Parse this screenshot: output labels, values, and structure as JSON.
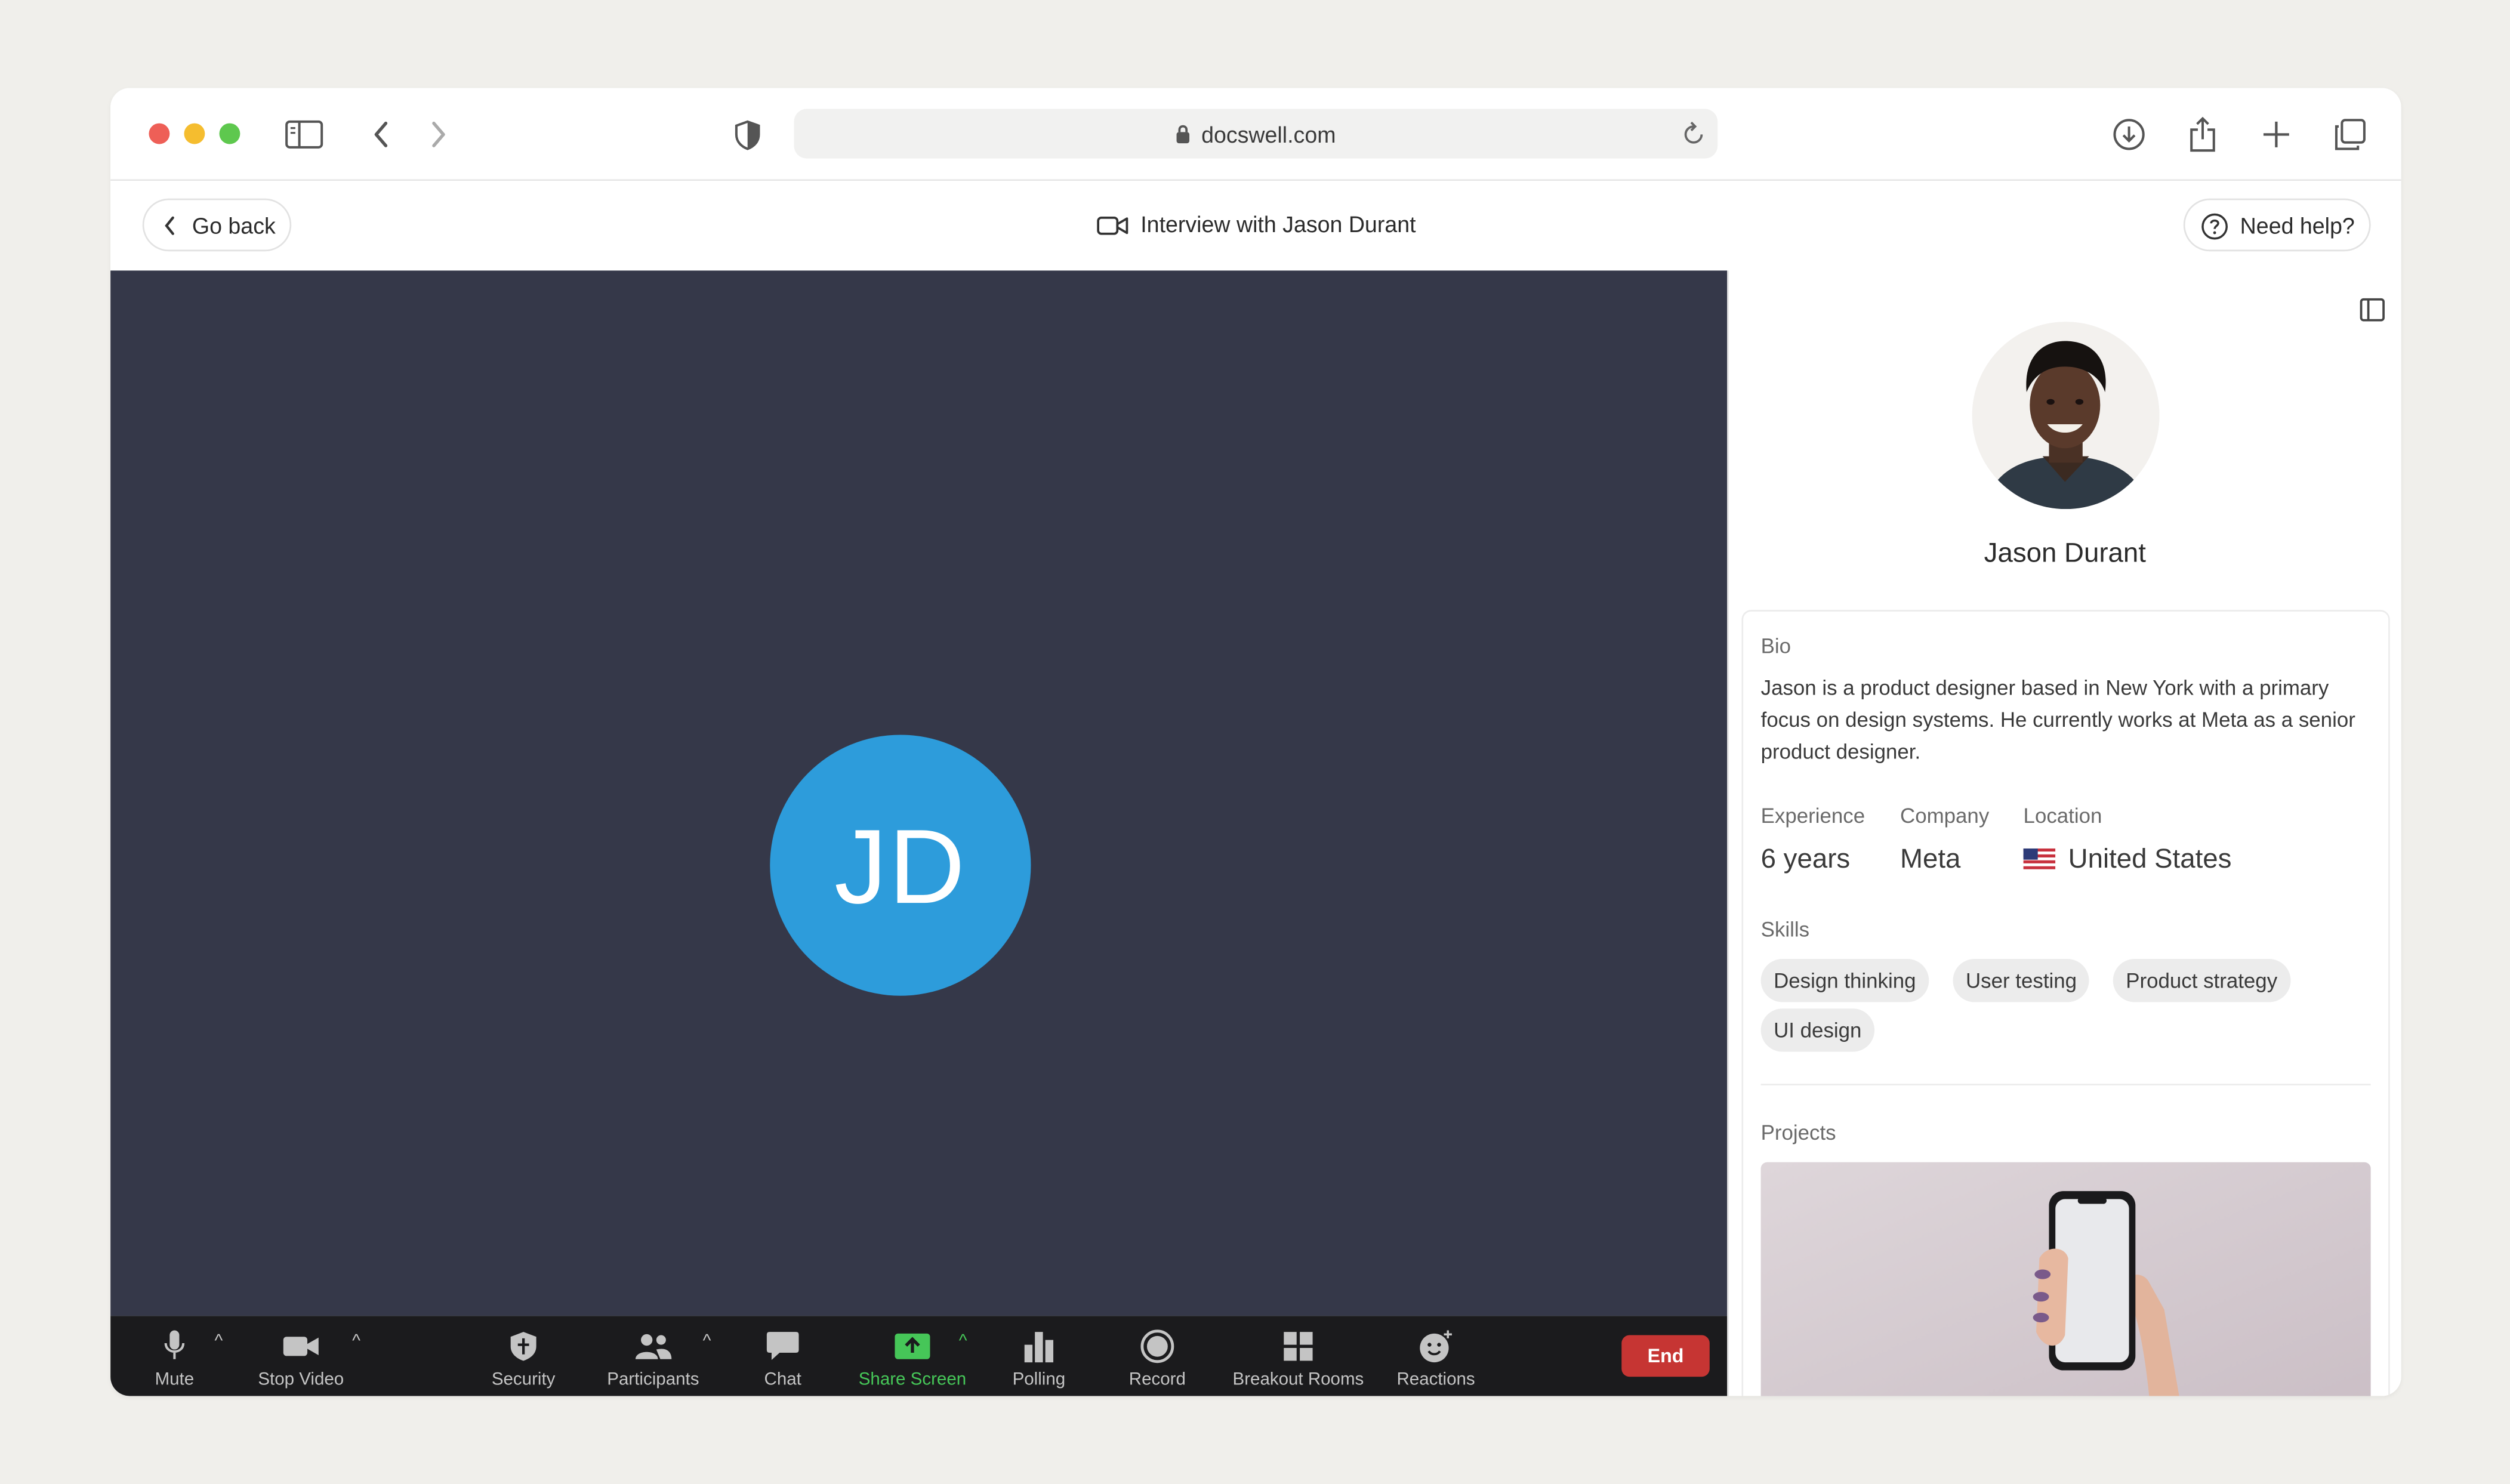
{
  "browser": {
    "url": "docswell.com",
    "icons": [
      "sidebar-icon",
      "back-icon",
      "forward-icon",
      "shield-icon",
      "lock-icon",
      "reload-icon",
      "download-icon",
      "share-icon",
      "new-tab-icon",
      "tabs-icon"
    ]
  },
  "header": {
    "back_label": "Go back",
    "title": "Interview with Jason Durant",
    "help_label": "Need help?"
  },
  "call": {
    "initials": "JD",
    "avatar_color": "#2d9cdb",
    "toolbar": {
      "mute": "Mute",
      "stop_video": "Stop Video",
      "security": "Security",
      "participants": "Participants",
      "chat": "Chat",
      "share_screen": "Share Screen",
      "polling": "Polling",
      "record": "Record",
      "breakout_rooms": "Breakout Rooms",
      "reactions": "Reactions",
      "end": "End"
    },
    "colors": {
      "share_green": "#46c658",
      "end_red": "#c63533",
      "video_bg": "#353849"
    }
  },
  "profile": {
    "name": "Jason Durant",
    "bio_label": "Bio",
    "bio": "Jason is a product designer based in New York with a primary focus on design systems. He currently works at Meta as a senior product designer.",
    "experience_label": "Experience",
    "experience": "6 years",
    "company_label": "Company",
    "company": "Meta",
    "location_label": "Location",
    "location": "United States",
    "skills_label": "Skills",
    "skills": [
      "Design thinking",
      "User testing",
      "Product strategy",
      "UI design"
    ],
    "projects_label": "Projects"
  }
}
